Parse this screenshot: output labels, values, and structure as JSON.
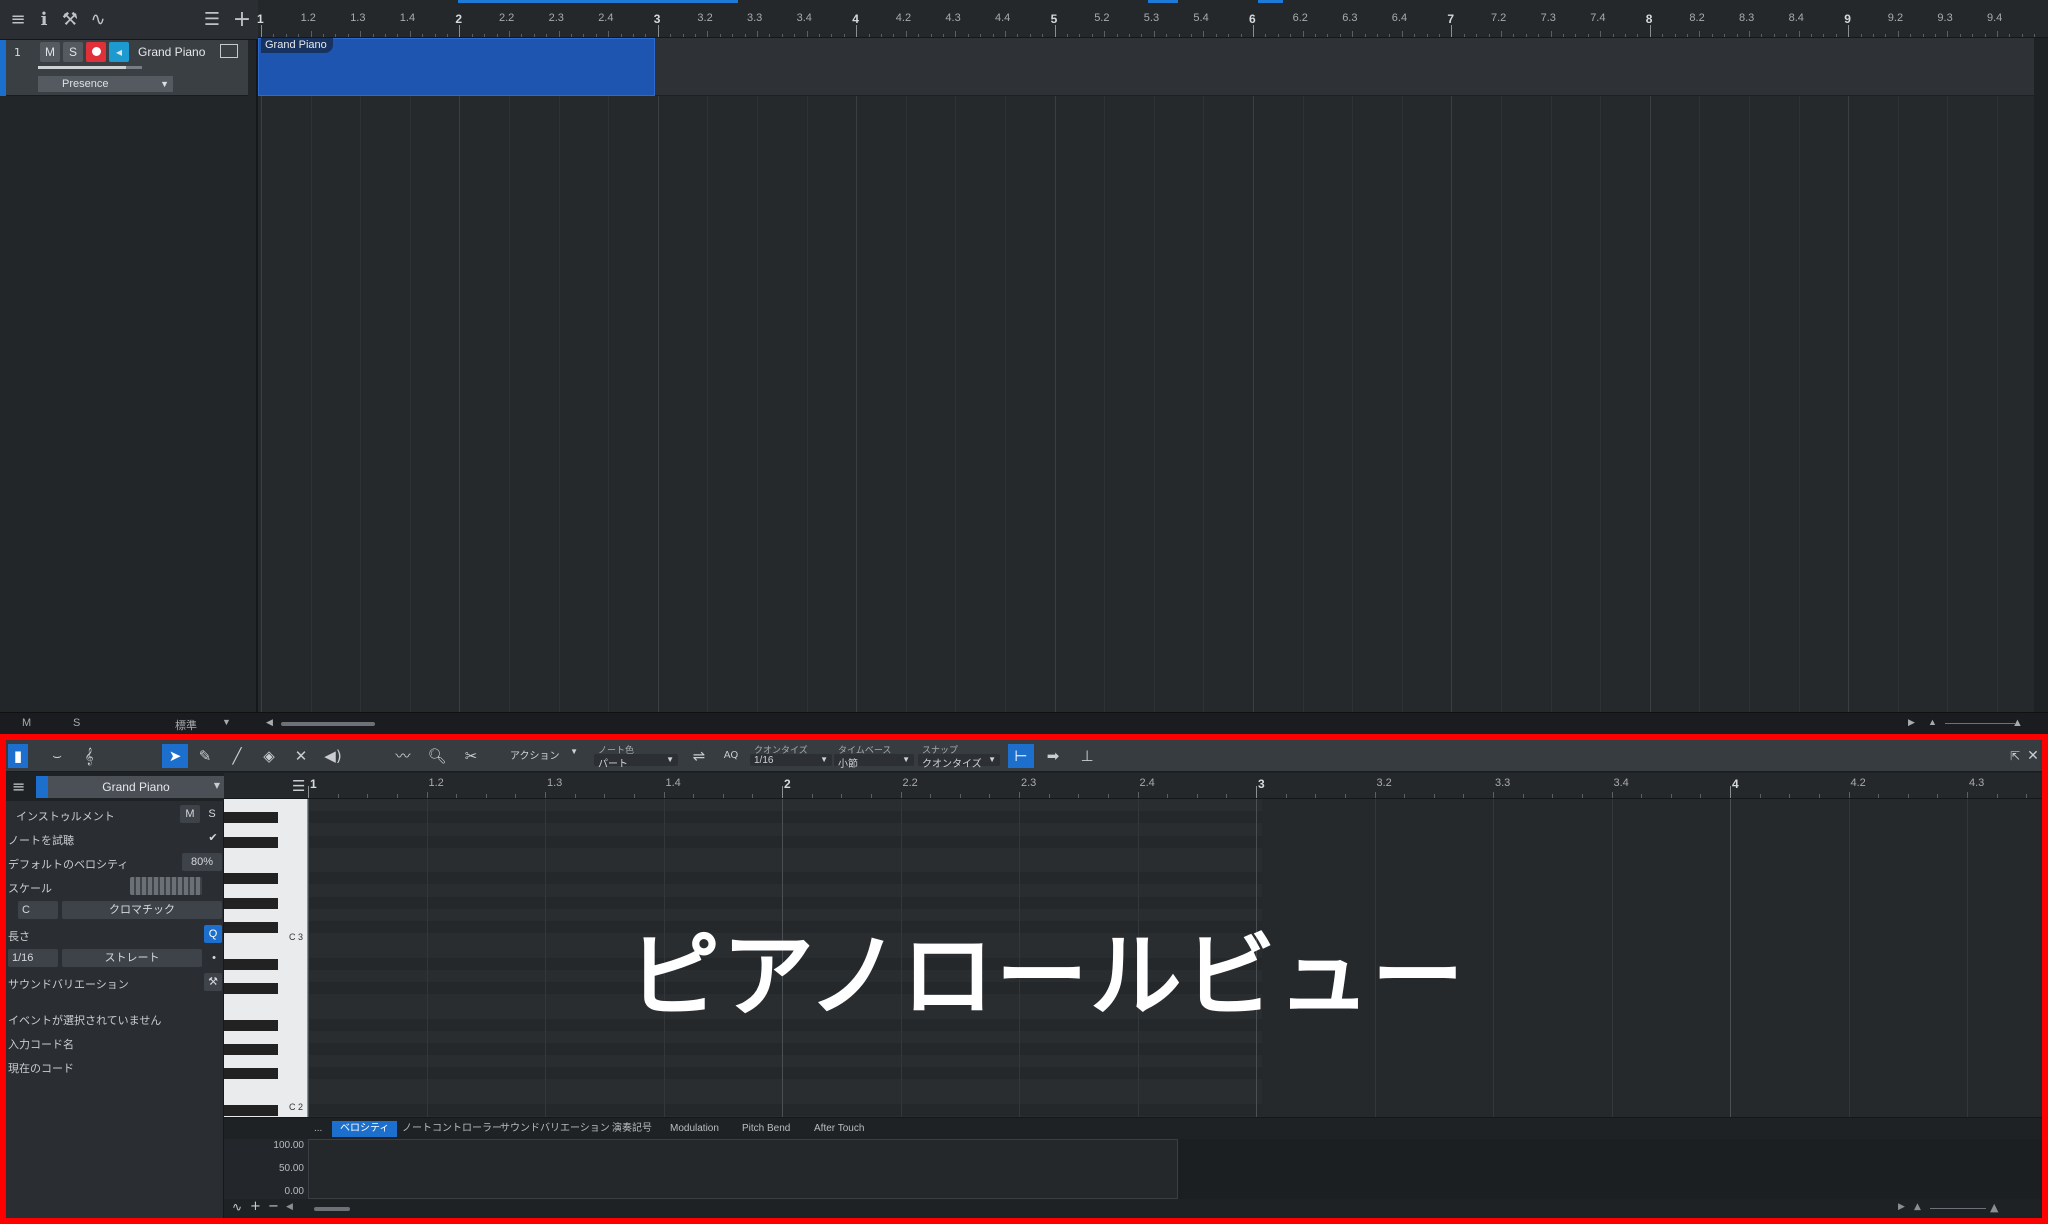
{
  "arrange": {
    "track": {
      "number": "1",
      "mute": "M",
      "solo": "S",
      "name": "Grand Piano",
      "preset": "Presence",
      "volume_fraction": 0.85
    },
    "event_label": "Grand Piano",
    "ruler_labels": [
      "1",
      "1.2",
      "1.3",
      "1.4",
      "2",
      "2.2",
      "2.3",
      "2.4",
      "3",
      "3.2",
      "3.3",
      "3.4",
      "4",
      "4.2",
      "4.3",
      "4.4",
      "5",
      "5.2",
      "5.3",
      "5.4",
      "6",
      "6.2",
      "6.3",
      "6.4",
      "7",
      "7.2",
      "7.3",
      "7.4",
      "8",
      "8.2",
      "8.3",
      "8.4",
      "9",
      "9.2",
      "9.3",
      "9.4"
    ],
    "status": {
      "m": "M",
      "s": "S",
      "mode": "標準"
    }
  },
  "editor": {
    "toolbar": {
      "action": "アクション",
      "note_color_label": "ノート色",
      "note_color_value": "パート",
      "aq": "AQ",
      "quantize_label": "クオンタイズ",
      "quantize_value": "1/16",
      "timebase_label": "タイムベース",
      "timebase_value": "小節",
      "snap_label": "スナップ",
      "snap_value": "クオンタイズ"
    },
    "inspector": {
      "title": "Grand Piano",
      "instrument": "インストゥルメント",
      "m": "M",
      "s": "S",
      "audition": "ノートを試聴",
      "default_velocity_label": "デフォルトのベロシティ",
      "default_velocity": "80%",
      "scale_label": "スケール",
      "scale_root": "C",
      "scale_type": "クロマチック",
      "length_label": "長さ",
      "length_value": "1/16",
      "length_mode": "ストレート",
      "q_button": "Q",
      "sound_variation": "サウンドバリエーション",
      "no_event": "イベントが選択されていません",
      "input_chord": "入力コード名",
      "current_chord": "現在のコード"
    },
    "ruler_labels": [
      "1",
      "1.2",
      "1.3",
      "1.4",
      "2",
      "2.2",
      "2.3",
      "2.4",
      "3",
      "3.2",
      "3.3",
      "3.4",
      "4",
      "4.2",
      "4.3"
    ],
    "key_labels": {
      "c3": "C 3",
      "c2": "C 2"
    },
    "overlay_caption": "ピアノロールビュー",
    "lane_tabs": [
      "ベロシティ",
      "ノートコントローラー",
      "サウンドバリエーション",
      "演奏記号",
      "Modulation",
      "Pitch Bend",
      "After Touch"
    ],
    "lane_more": "...",
    "velocity_scale": [
      "100.00",
      "50.00",
      "0.00"
    ]
  },
  "colors": {
    "accent": "#1d6fce",
    "event": "#1e55b0",
    "highlight_border": "#ff0000",
    "record": "#e0303a"
  }
}
